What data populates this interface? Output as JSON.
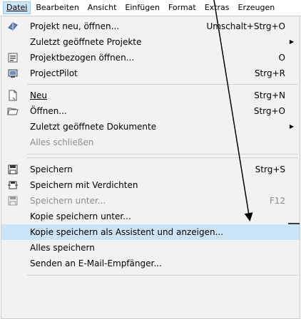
{
  "menubar": {
    "items": [
      {
        "label": "Datei"
      },
      {
        "label": "Bearbeiten"
      },
      {
        "label": "Ansicht"
      },
      {
        "label": "Einfügen"
      },
      {
        "label": "Format"
      },
      {
        "label": "Extras"
      },
      {
        "label": "Erzeugen"
      }
    ]
  },
  "menu": {
    "items": [
      {
        "label": "Projekt neu, öffnen...",
        "shortcut": "Umschalt+Strg+O",
        "icon": "project-icon"
      },
      {
        "label": "Zuletzt geöffnete Projekte",
        "submenu": true
      },
      {
        "label": "Projektbezogen öffnen...",
        "shortcut": "O",
        "icon": "project-open-icon"
      },
      {
        "label": "ProjectPilot",
        "shortcut": "Strg+R",
        "icon": "projectpilot-icon"
      },
      {
        "label": "Neu",
        "shortcut": "Strg+N",
        "icon": "new-document-icon"
      },
      {
        "label": "Öffnen...",
        "shortcut": "Strg+O",
        "icon": "open-folder-icon"
      },
      {
        "label": "Zuletzt geöffnete Dokumente",
        "submenu": true
      },
      {
        "label": "Alles schließen",
        "disabled": true
      },
      {
        "label": "Speichern",
        "shortcut": "Strg+S",
        "icon": "save-icon"
      },
      {
        "label": "Speichern mit Verdichten",
        "icon": "save-compress-icon"
      },
      {
        "label": "Speichern unter...",
        "shortcut": "F12",
        "disabled": true,
        "icon": "save-as-icon"
      },
      {
        "label": "Kopie speichern unter..."
      },
      {
        "label": "Kopie speichern als Assistent und anzeigen...",
        "highlighted": true
      },
      {
        "label": "Alles speichern"
      },
      {
        "label": "Senden an E-Mail-Empfänger..."
      }
    ]
  },
  "colors": {
    "highlight": "#cce4f7",
    "menu_bg": "#f2f2f2",
    "disabled_text": "#8d8d8d"
  }
}
